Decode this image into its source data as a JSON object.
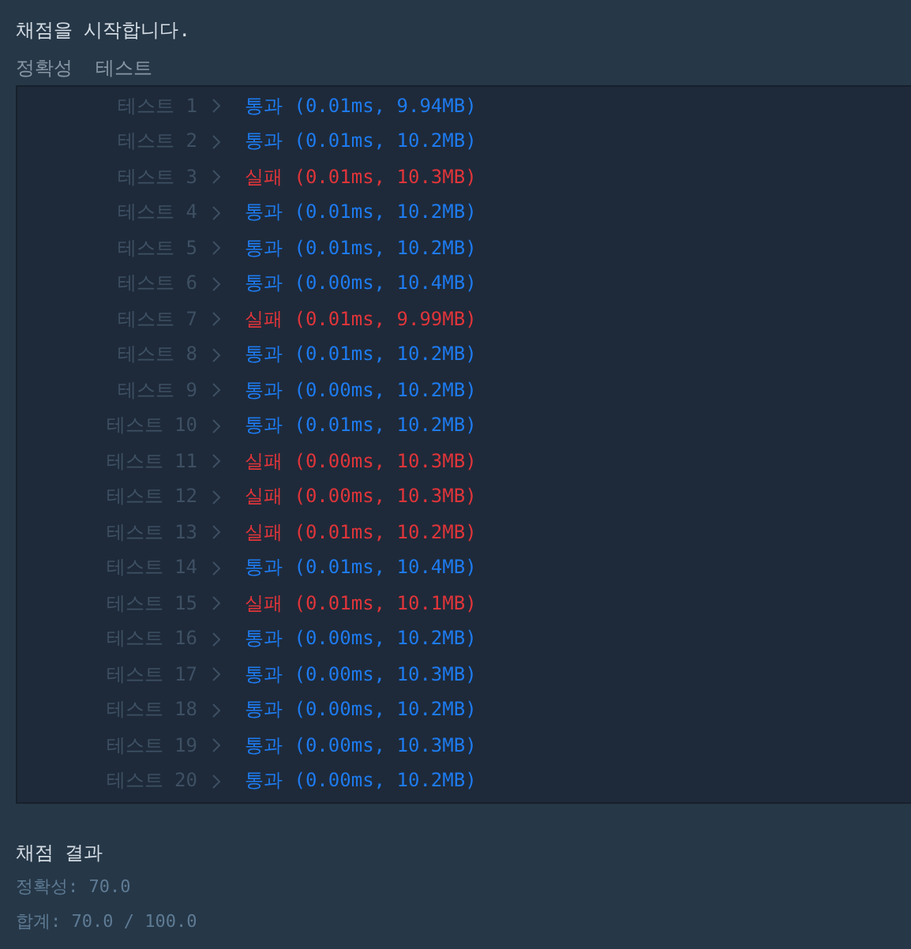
{
  "intro": "채점을 시작합니다.",
  "section": "정확성  테스트",
  "tests": [
    {
      "label": "테스트 1",
      "kind": "pass",
      "result": "통과 (0.01ms, 9.94MB)"
    },
    {
      "label": "테스트 2",
      "kind": "pass",
      "result": "통과 (0.01ms, 10.2MB)"
    },
    {
      "label": "테스트 3",
      "kind": "fail",
      "result": "실패 (0.01ms, 10.3MB)"
    },
    {
      "label": "테스트 4",
      "kind": "pass",
      "result": "통과 (0.01ms, 10.2MB)"
    },
    {
      "label": "테스트 5",
      "kind": "pass",
      "result": "통과 (0.01ms, 10.2MB)"
    },
    {
      "label": "테스트 6",
      "kind": "pass",
      "result": "통과 (0.00ms, 10.4MB)"
    },
    {
      "label": "테스트 7",
      "kind": "fail",
      "result": "실패 (0.01ms, 9.99MB)"
    },
    {
      "label": "테스트 8",
      "kind": "pass",
      "result": "통과 (0.01ms, 10.2MB)"
    },
    {
      "label": "테스트 9",
      "kind": "pass",
      "result": "통과 (0.00ms, 10.2MB)"
    },
    {
      "label": "테스트 10",
      "kind": "pass",
      "result": "통과 (0.01ms, 10.2MB)"
    },
    {
      "label": "테스트 11",
      "kind": "fail",
      "result": "실패 (0.00ms, 10.3MB)"
    },
    {
      "label": "테스트 12",
      "kind": "fail",
      "result": "실패 (0.00ms, 10.3MB)"
    },
    {
      "label": "테스트 13",
      "kind": "fail",
      "result": "실패 (0.01ms, 10.2MB)"
    },
    {
      "label": "테스트 14",
      "kind": "pass",
      "result": "통과 (0.01ms, 10.4MB)"
    },
    {
      "label": "테스트 15",
      "kind": "fail",
      "result": "실패 (0.01ms, 10.1MB)"
    },
    {
      "label": "테스트 16",
      "kind": "pass",
      "result": "통과 (0.00ms, 10.2MB)"
    },
    {
      "label": "테스트 17",
      "kind": "pass",
      "result": "통과 (0.00ms, 10.3MB)"
    },
    {
      "label": "테스트 18",
      "kind": "pass",
      "result": "통과 (0.00ms, 10.2MB)"
    },
    {
      "label": "테스트 19",
      "kind": "pass",
      "result": "통과 (0.00ms, 10.3MB)"
    },
    {
      "label": "테스트 20",
      "kind": "pass",
      "result": "통과 (0.00ms, 10.2MB)"
    }
  ],
  "summary": {
    "title": "채점 결과",
    "accuracy": "정확성: 70.0",
    "total": "합계: 70.0 / 100.0"
  }
}
